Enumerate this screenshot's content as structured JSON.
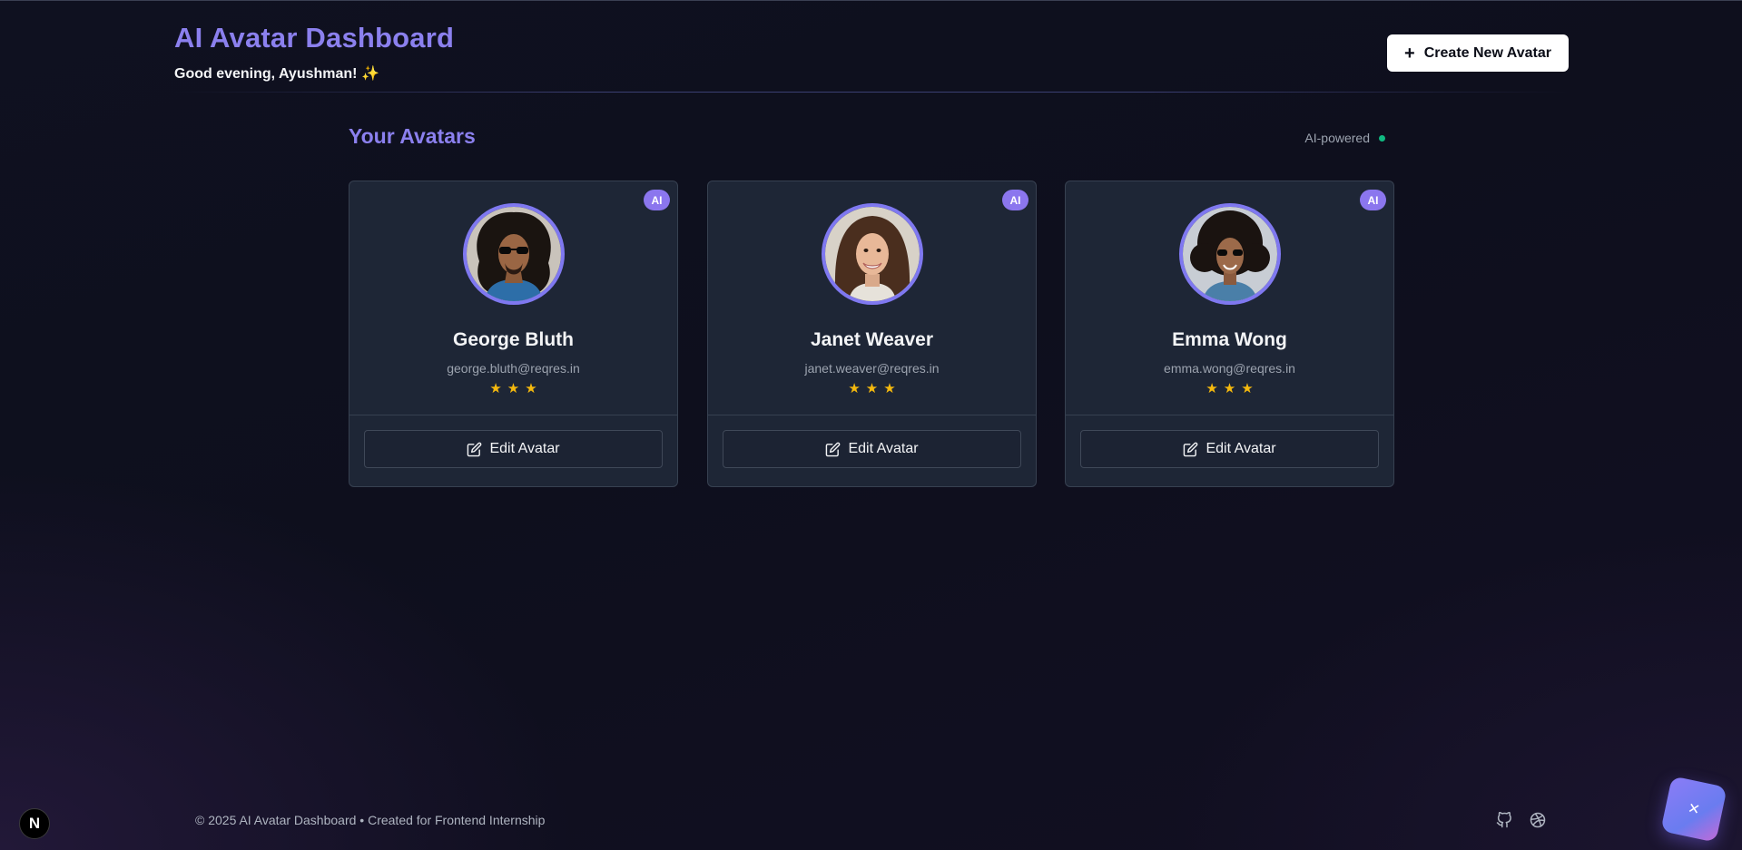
{
  "header": {
    "title": "AI Avatar Dashboard",
    "greeting": "Good evening, Ayushman! ✨",
    "create_button": "Create New Avatar"
  },
  "section": {
    "title": "Your Avatars",
    "status_label": "AI-powered"
  },
  "avatars": [
    {
      "badge": "AI",
      "name": "George Bluth",
      "email": "george.bluth@reqres.in",
      "rating": 3,
      "edit_label": "Edit Avatar"
    },
    {
      "badge": "AI",
      "name": "Janet Weaver",
      "email": "janet.weaver@reqres.in",
      "rating": 3,
      "edit_label": "Edit Avatar"
    },
    {
      "badge": "AI",
      "name": "Emma Wong",
      "email": "emma.wong@reqres.in",
      "rating": 3,
      "edit_label": "Edit Avatar"
    }
  ],
  "footer": {
    "text": "© 2025 AI Avatar Dashboard • Created for Frontend Internship"
  },
  "next_badge": "N",
  "colors": {
    "accent": "#8b80ee",
    "badge": "#8b76ee",
    "star": "#f5b90e",
    "status_dot": "#10b981"
  }
}
